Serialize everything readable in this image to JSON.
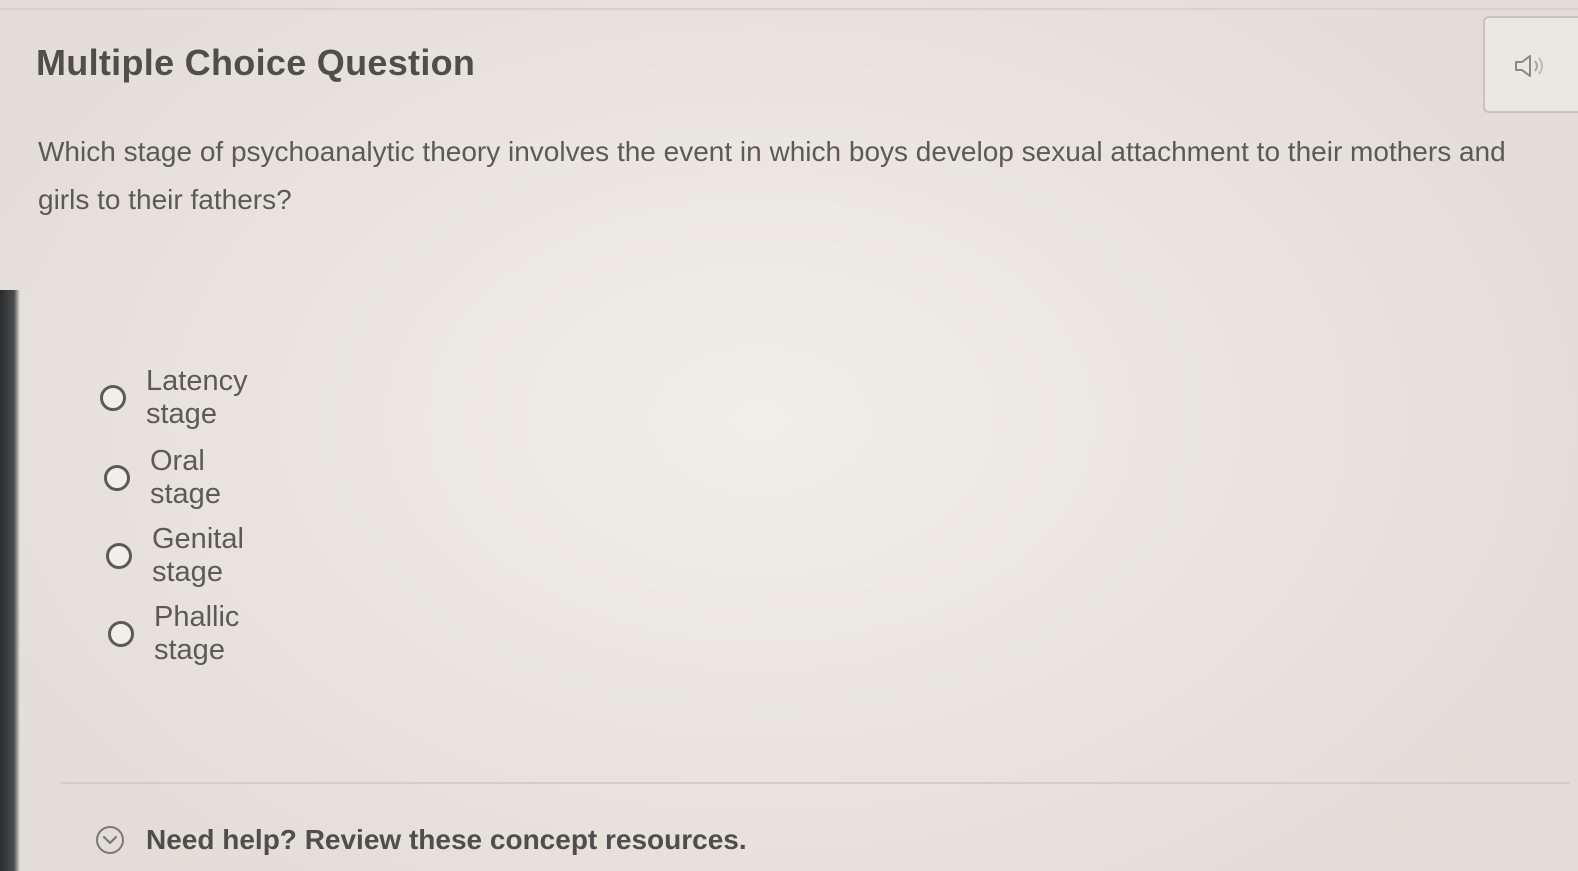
{
  "header": {
    "title": "Multiple Choice Question"
  },
  "question": {
    "text": "Which stage of psychoanalytic theory involves the event in which boys develop sexual attachment to their mothers and girls to their fathers?"
  },
  "options": [
    {
      "label": "Latency stage",
      "selected": false
    },
    {
      "label": "Oral stage",
      "selected": false
    },
    {
      "label": "Genital stage",
      "selected": false
    },
    {
      "label": "Phallic stage",
      "selected": false
    }
  ],
  "help": {
    "label": "Need help? Review these concept resources.",
    "icon": "chevron-down-circle-icon"
  },
  "audio": {
    "icon": "speaker-icon"
  }
}
